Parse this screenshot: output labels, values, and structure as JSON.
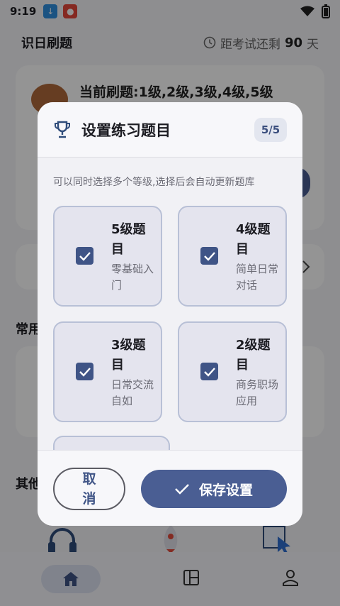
{
  "status_bar": {
    "time": "9:19"
  },
  "page": {
    "title": "识日刷题",
    "countdown_prefix": "距考试还剩",
    "countdown_days": "90",
    "countdown_unit": "天",
    "current_levels": "当前刷题:1级,2级,3级,4级,5级",
    "section_common": "常用",
    "section_other": "其他"
  },
  "dialog": {
    "title": "设置练习题目",
    "page_indicator": "5/5",
    "subtitle": "可以同时选择多个等级,选择后会自动更新题库",
    "options": [
      {
        "title": "5级题目",
        "desc": "零基础入门",
        "checked": true
      },
      {
        "title": "4级题目",
        "desc": "简单日常对话",
        "checked": true
      },
      {
        "title": "3级题目",
        "desc": "日常交流自如",
        "checked": true
      },
      {
        "title": "2级题目",
        "desc": "商务职场应用",
        "checked": true
      }
    ],
    "cancel_label": "取消",
    "save_label": "保存设置"
  },
  "colors": {
    "accent": "#4a5e93",
    "checkbox": "#3f5486",
    "option_border": "#b8c0d6"
  }
}
